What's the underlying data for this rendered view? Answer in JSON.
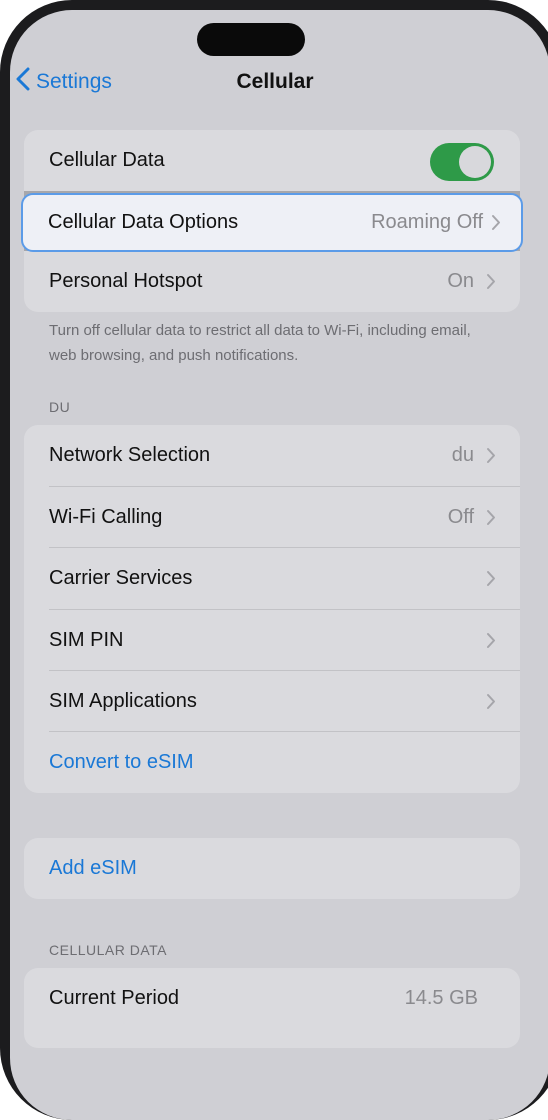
{
  "nav": {
    "back_label": "Settings",
    "title": "Cellular"
  },
  "group1": {
    "cellular_data": {
      "label": "Cellular Data",
      "enabled": true
    },
    "cellular_data_options": {
      "label": "Cellular Data Options",
      "value": "Roaming Off"
    },
    "personal_hotspot": {
      "label": "Personal Hotspot",
      "value": "On"
    }
  },
  "footnote": "Turn off cellular data to restrict all data to Wi-Fi, including email, web browsing, and push notifications.",
  "carrier_section": {
    "header": "DU",
    "items": [
      {
        "label": "Network Selection",
        "value": "du"
      },
      {
        "label": "Wi-Fi Calling",
        "value": "Off"
      },
      {
        "label": "Carrier Services",
        "value": ""
      },
      {
        "label": "SIM PIN",
        "value": ""
      },
      {
        "label": "SIM Applications",
        "value": ""
      }
    ],
    "convert_esim": "Convert to eSIM"
  },
  "add_esim": "Add eSIM",
  "usage_section": {
    "header": "CELLULAR DATA",
    "current_period": {
      "label": "Current Period",
      "value": "14.5 GB"
    }
  },
  "colors": {
    "accent": "#1a78d6",
    "toggle_on": "#2e9a48",
    "screen_bg": "#cfcfd4",
    "group_bg": "#dadade"
  }
}
